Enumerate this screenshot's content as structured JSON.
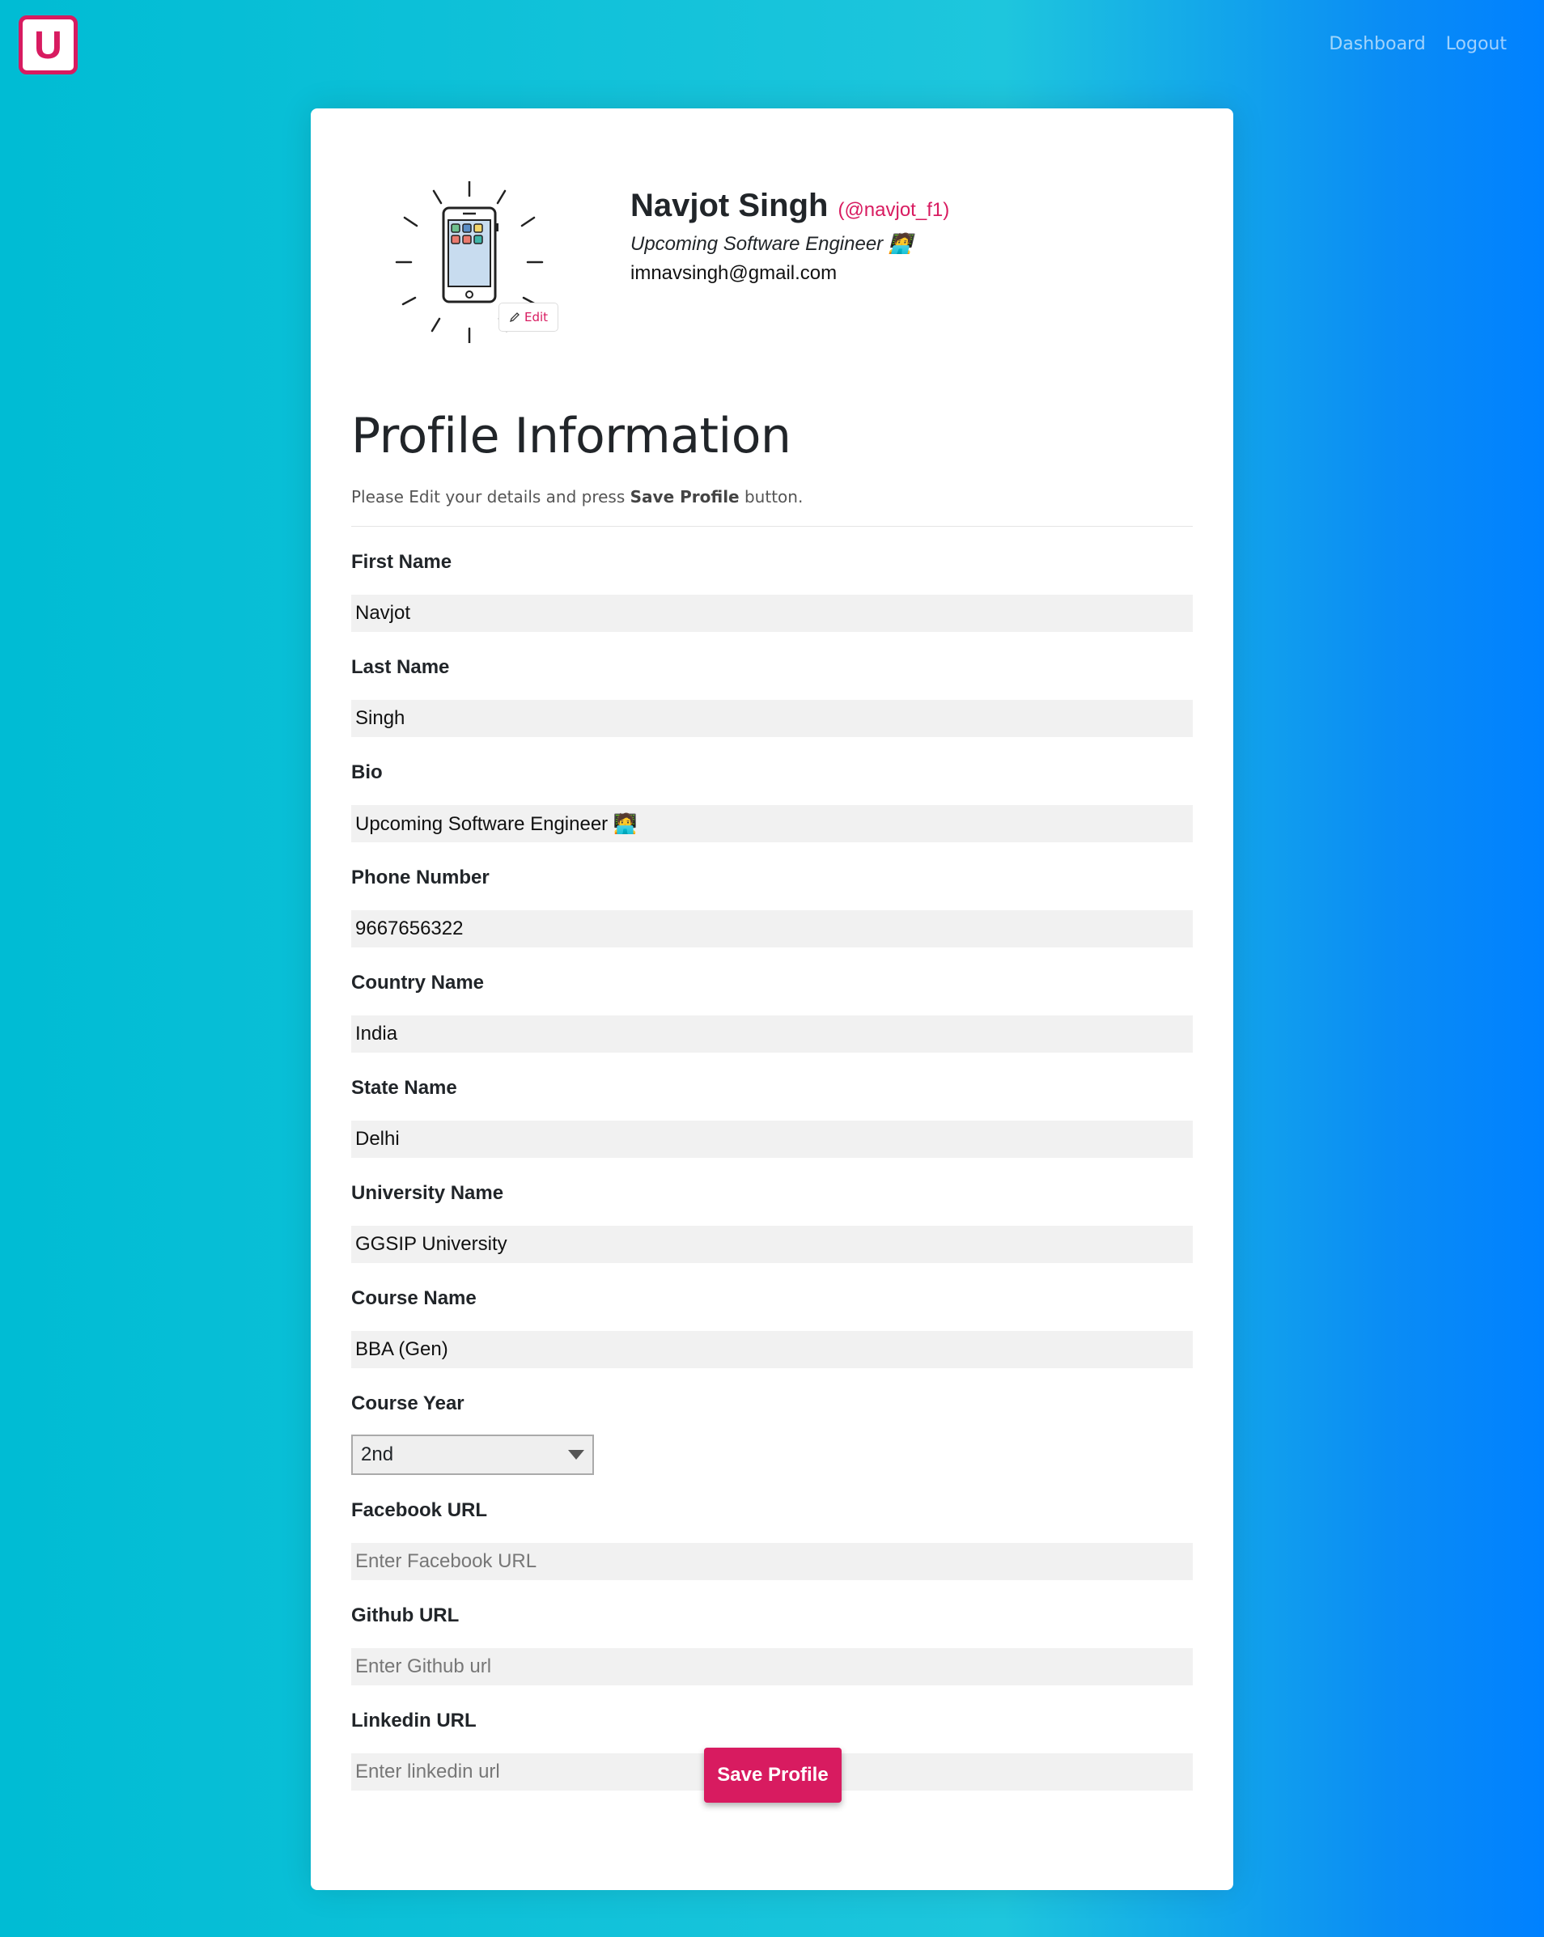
{
  "header": {
    "logo_letter": "U",
    "nav": [
      "Dashboard",
      "Logout"
    ]
  },
  "profile": {
    "name": "Navjot Singh",
    "handle": "(@navjot_f1)",
    "bio": "Upcoming Software Engineer 🧑‍💻",
    "email": "imnavsingh@gmail.com",
    "edit_label": "Edit"
  },
  "form": {
    "title": "Profile Information",
    "subtitle_pre": "Please Edit your details and press ",
    "subtitle_bold": "Save Profile",
    "subtitle_post": " button.",
    "fields": [
      {
        "label": "First Name",
        "value": "Navjot",
        "placeholder": ""
      },
      {
        "label": "Last Name",
        "value": "Singh",
        "placeholder": ""
      },
      {
        "label": "Bio",
        "value": "Upcoming Software Engineer 🧑‍💻",
        "placeholder": ""
      },
      {
        "label": "Phone Number",
        "value": "9667656322",
        "placeholder": ""
      },
      {
        "label": "Country Name",
        "value": "India",
        "placeholder": ""
      },
      {
        "label": "State Name",
        "value": "Delhi",
        "placeholder": ""
      },
      {
        "label": "University Name",
        "value": "GGSIP University",
        "placeholder": ""
      },
      {
        "label": "Course Name",
        "value": "BBA (Gen)",
        "placeholder": ""
      }
    ],
    "course_year": {
      "label": "Course Year",
      "value": "2nd"
    },
    "url_fields": [
      {
        "label": "Facebook URL",
        "value": "",
        "placeholder": "Enter Facebook URL"
      },
      {
        "label": "Github URL",
        "value": "",
        "placeholder": "Enter Github url"
      },
      {
        "label": "Linkedin URL",
        "value": "",
        "placeholder": "Enter linkedin url"
      }
    ],
    "save_label": "Save Profile"
  },
  "colors": {
    "accent": "#d81b60",
    "bg_start": "#00bcd4",
    "bg_end": "#0081ff"
  }
}
